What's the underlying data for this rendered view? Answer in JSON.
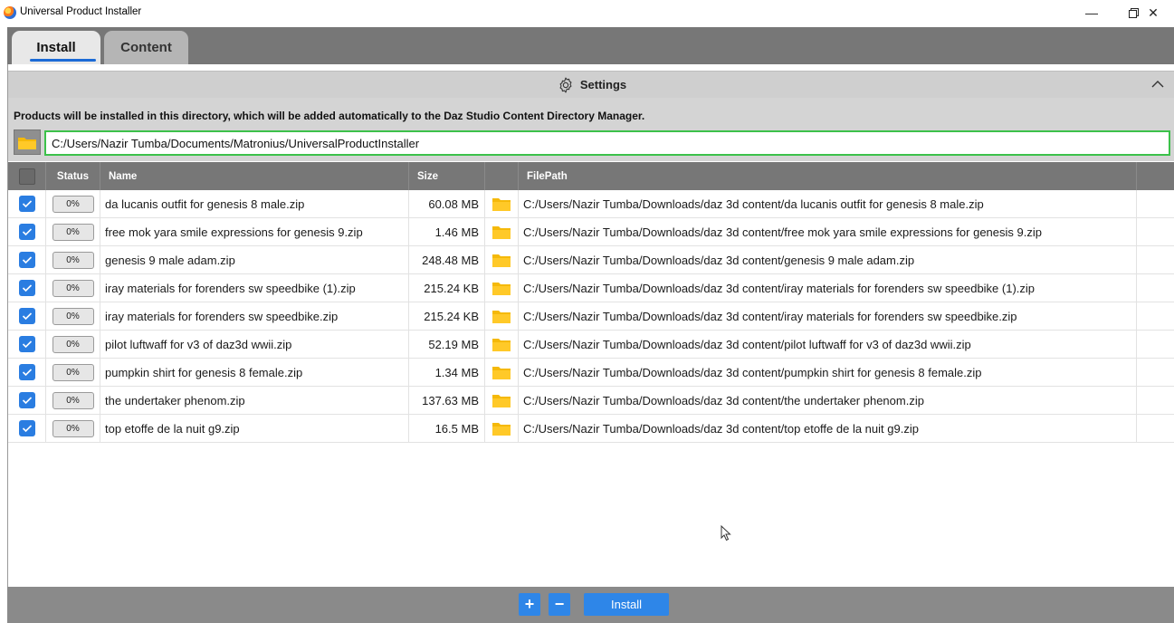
{
  "window": {
    "title": "Universal Product Installer",
    "minimize_glyph": "—",
    "maximize_glyph": "❐",
    "close_glyph": "✕"
  },
  "tabs": [
    {
      "label": "Install",
      "active": true
    },
    {
      "label": "Content",
      "active": false
    }
  ],
  "settings": {
    "label": "Settings",
    "icon": "gear-icon",
    "collapse_glyph": "︿"
  },
  "install_dir": {
    "info": "Products will be installed in this directory, which will be added automatically to the Daz Studio Content Directory Manager.",
    "path": "C:/Users/Nazir Tumba/Documents/Matronius/UniversalProductInstaller"
  },
  "table": {
    "headers": {
      "status": "Status",
      "name": "Name",
      "size": "Size",
      "filepath": "FilePath"
    },
    "rows": [
      {
        "checked": true,
        "status": "0%",
        "name": "da lucanis outfit for genesis 8 male.zip",
        "size": "60.08 MB",
        "path": "C:/Users/Nazir Tumba/Downloads/daz 3d content/da lucanis outfit for genesis 8 male.zip"
      },
      {
        "checked": true,
        "status": "0%",
        "name": "free mok yara smile expressions for genesis 9.zip",
        "size": "1.46 MB",
        "path": "C:/Users/Nazir Tumba/Downloads/daz 3d content/free mok yara smile expressions for genesis 9.zip"
      },
      {
        "checked": true,
        "status": "0%",
        "name": "genesis 9 male adam.zip",
        "size": "248.48 MB",
        "path": "C:/Users/Nazir Tumba/Downloads/daz 3d content/genesis 9 male adam.zip"
      },
      {
        "checked": true,
        "status": "0%",
        "name": "iray materials for forenders sw speedbike (1).zip",
        "size": "215.24 KB",
        "path": "C:/Users/Nazir Tumba/Downloads/daz 3d content/iray materials for forenders sw speedbike (1).zip"
      },
      {
        "checked": true,
        "status": "0%",
        "name": "iray materials for forenders sw speedbike.zip",
        "size": "215.24 KB",
        "path": "C:/Users/Nazir Tumba/Downloads/daz 3d content/iray materials for forenders sw speedbike.zip"
      },
      {
        "checked": true,
        "status": "0%",
        "name": "pilot luftwaff for v3 of daz3d wwii.zip",
        "size": "52.19 MB",
        "path": "C:/Users/Nazir Tumba/Downloads/daz 3d content/pilot luftwaff for v3 of daz3d wwii.zip"
      },
      {
        "checked": true,
        "status": "0%",
        "name": "pumpkin shirt for genesis 8 female.zip",
        "size": "1.34 MB",
        "path": "C:/Users/Nazir Tumba/Downloads/daz 3d content/pumpkin shirt for genesis 8 female.zip"
      },
      {
        "checked": true,
        "status": "0%",
        "name": "the undertaker phenom.zip",
        "size": "137.63 MB",
        "path": "C:/Users/Nazir Tumba/Downloads/daz 3d content/the undertaker phenom.zip"
      },
      {
        "checked": true,
        "status": "0%",
        "name": "top etoffe de la nuit g9.zip",
        "size": "16.5 MB",
        "path": "C:/Users/Nazir Tumba/Downloads/daz 3d content/top etoffe de la nuit g9.zip"
      }
    ]
  },
  "toolbar": {
    "add_label": "+",
    "remove_label": "−",
    "install_label": "Install"
  },
  "colors": {
    "accent": "#2e86e8",
    "header_gray": "#777777",
    "input_border": "#3cc14a",
    "folder": "#f5b90a"
  }
}
